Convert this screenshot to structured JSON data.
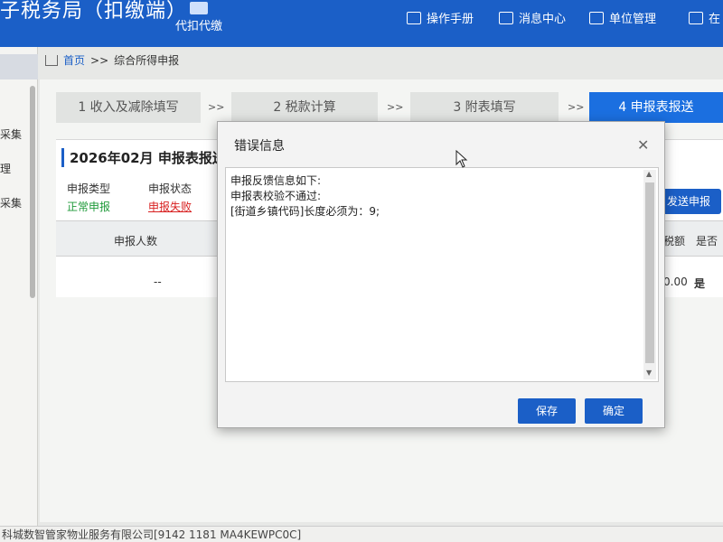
{
  "header": {
    "app_title": "子税务局（扣缴端）",
    "daikou_label": "代扣代缴",
    "nav": [
      {
        "label": "操作手册",
        "icon": "manual-icon"
      },
      {
        "label": "消息中心",
        "icon": "message-icon"
      },
      {
        "label": "单位管理",
        "icon": "building-icon"
      },
      {
        "label": "在",
        "icon": "monitor-icon"
      }
    ],
    "color": "#1b5fc7"
  },
  "left_tabs": [
    "采集",
    "理",
    "采集"
  ],
  "breadcrumb": {
    "home": "首页",
    "sep": ">>",
    "current": "综合所得申报"
  },
  "steps": [
    {
      "label": "1 收入及减除填写",
      "active": false
    },
    {
      "label": "2 税款计算",
      "active": false
    },
    {
      "label": "3 附表填写",
      "active": false
    },
    {
      "label": "4 申报表报送",
      "active": true
    }
  ],
  "step_arrow": ">>",
  "report": {
    "period_title": "2026年02月  申报表报送",
    "type_label": "申报类型",
    "type_value": "正常申报",
    "status_label": "申报状态",
    "status_value": "申报失败",
    "send_button": "发送申报"
  },
  "table": {
    "headers": [
      "申报人数",
      "税额",
      "是否"
    ],
    "row": {
      "count": "--",
      "tax": "0.00",
      "flag": "是"
    }
  },
  "footer_text": "科城数智管家物业服务有限公司[9142 1181 MA4KEWPC0C]",
  "dialog": {
    "title": "错误信息",
    "close_glyph": "✕",
    "lines": [
      "申报反馈信息如下:",
      "申报表校验不通过:",
      "[街道乡镇代码]长度必须为：9;"
    ],
    "save_button": "保存",
    "ok_button": "确定"
  }
}
